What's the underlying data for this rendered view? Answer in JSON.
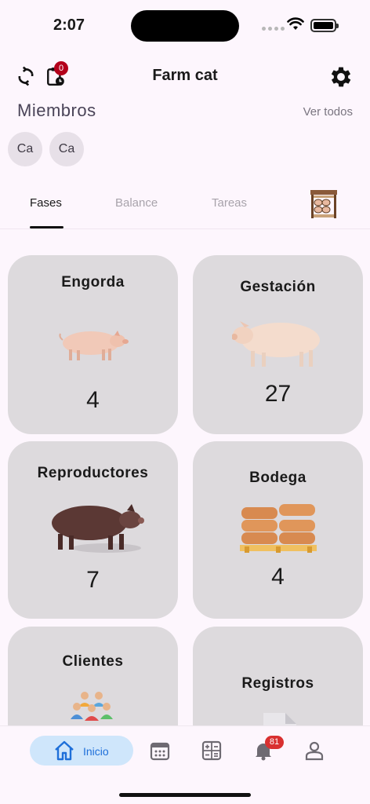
{
  "status": {
    "time": "2:07"
  },
  "app_bar": {
    "title": "Farm cat",
    "pending_badge": "0"
  },
  "members": {
    "title": "Miembros",
    "see_all": "Ver todos",
    "avatars": [
      "Ca",
      "Ca"
    ]
  },
  "tabs": {
    "items": [
      "Fases",
      "Balance",
      "Tareas"
    ],
    "active": "Fases"
  },
  "cards": [
    {
      "title": "Engorda",
      "count": "4",
      "icon": "pig-icon"
    },
    {
      "title": "Gestación",
      "count": "27",
      "icon": "sow-icon"
    },
    {
      "title": "Reproductores",
      "count": "7",
      "icon": "boar-icon"
    },
    {
      "title": "Bodega",
      "count": "4",
      "icon": "feed-sacks-icon"
    },
    {
      "title": "Clientes",
      "count": "",
      "icon": "people-icon"
    },
    {
      "title": "Registros",
      "count": "",
      "icon": "document-icon"
    }
  ],
  "bottom_nav": {
    "home_label": "Inicio",
    "notifications_badge": "81"
  },
  "colors": {
    "background": "#fdf6fd",
    "card": "#dddadd",
    "nav_active_bg": "#cfe6fb",
    "nav_active_text": "#1e6fd9",
    "badge_red": "#d93030"
  }
}
